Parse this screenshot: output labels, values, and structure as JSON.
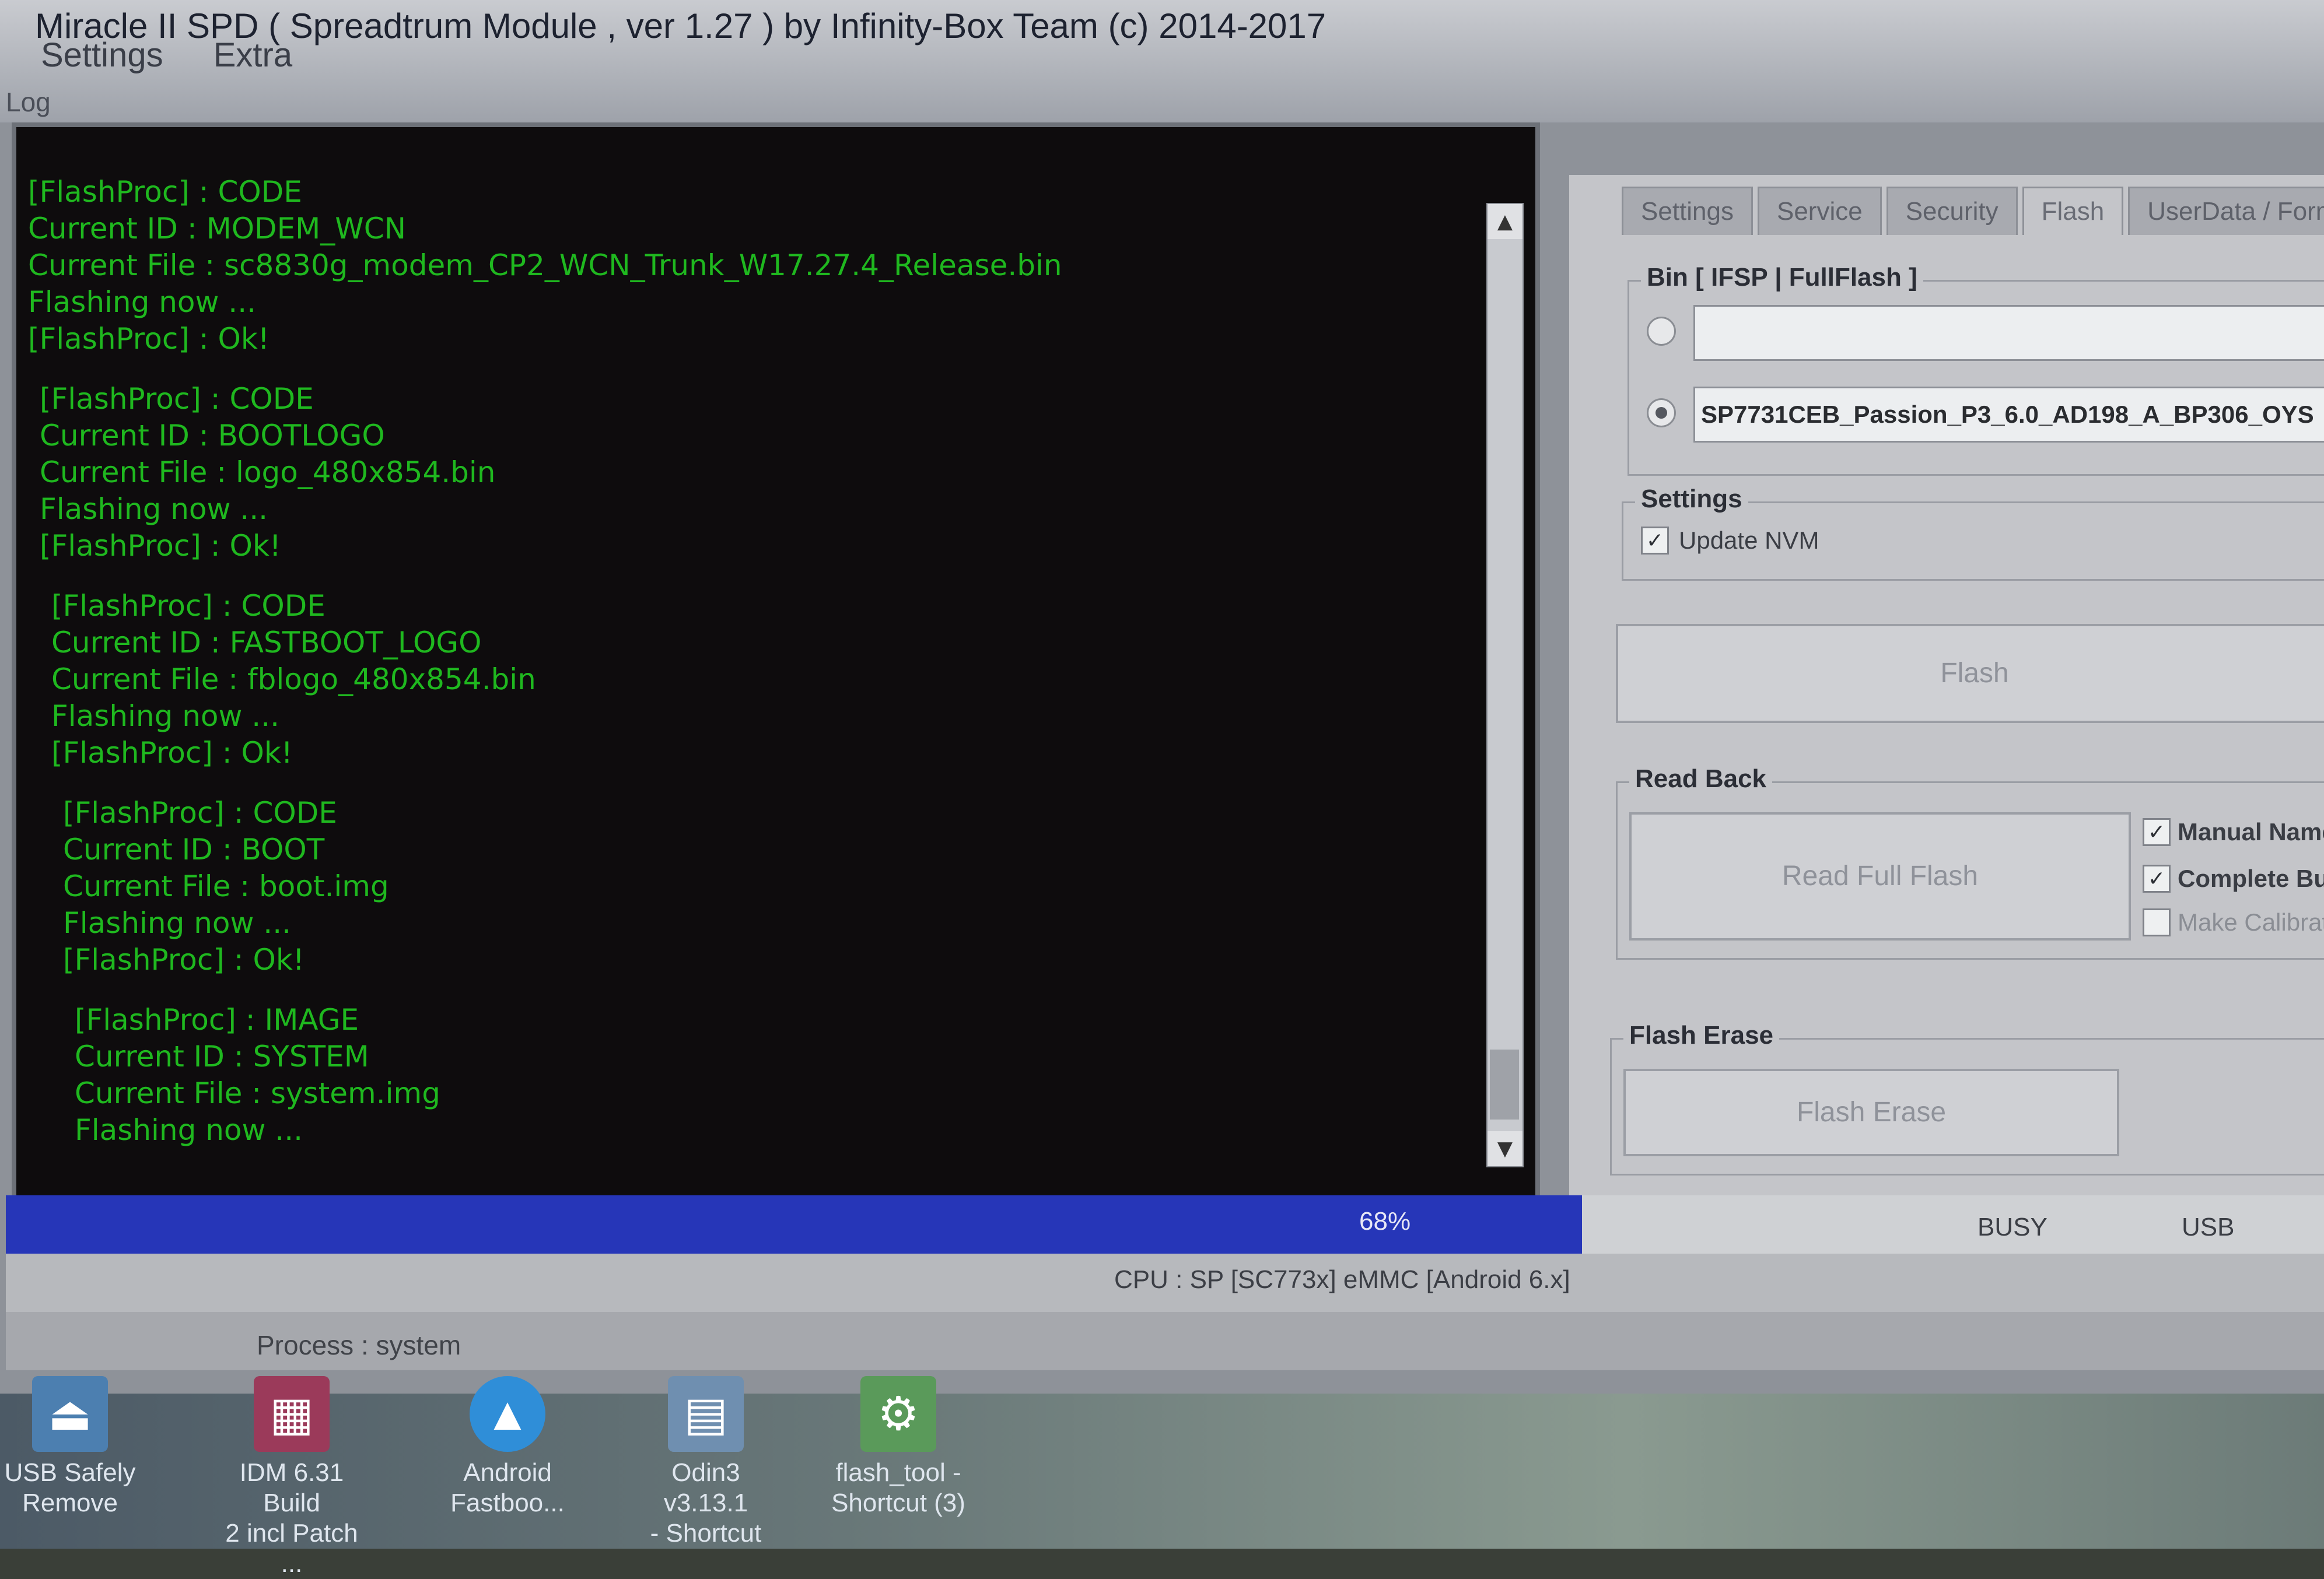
{
  "window": {
    "title": "Miracle II SPD ( Spreadtrum Module , ver 1.27 ) by Infinity-Box Team (c) 2014-2017",
    "menu": [
      "Settings",
      "Extra"
    ],
    "log_label": "Log"
  },
  "log": {
    "blocks": [
      {
        "lines": [
          "[FlashProc] : CODE",
          "Current ID : MODEM_WCN",
          "Current File : sc8830g_modem_CP2_WCN_Trunk_W17.27.4_Release.bin",
          "Flashing now ...",
          "[FlashProc] : Ok!"
        ]
      },
      {
        "lines": [
          "[FlashProc] : CODE",
          "Current ID : BOOTLOGO",
          "Current File : logo_480x854.bin",
          "Flashing now ...",
          "[FlashProc] : Ok!"
        ]
      },
      {
        "lines": [
          "[FlashProc] : CODE",
          "Current ID : FASTBOOT_LOGO",
          "Current File : fblogo_480x854.bin",
          "Flashing now ...",
          "[FlashProc] : Ok!"
        ]
      },
      {
        "lines": [
          "[FlashProc] : CODE",
          "Current ID : BOOT",
          "Current File : boot.img",
          "Flashing now ...",
          "[FlashProc] : Ok!"
        ]
      },
      {
        "lines": [
          "[FlashProc] : IMAGE",
          "Current ID : SYSTEM",
          "Current File : system.img",
          "Flashing now ..."
        ]
      }
    ],
    "text_color": "#1fb81f"
  },
  "tabs": [
    {
      "label": "Settings",
      "active": false
    },
    {
      "label": "Service",
      "active": false
    },
    {
      "label": "Security",
      "active": false
    },
    {
      "label": "Flash",
      "active": true
    },
    {
      "label": "UserData / Formats / O",
      "active": false
    }
  ],
  "bin_group": {
    "legend": "Bin [ IFSP | FullFlash ]",
    "option1_value": "",
    "option2_value": "SP7731CEB_Passion_P3_6.0_AD198_A_BP306_OYS"
  },
  "settings_group": {
    "legend": "Settings",
    "update_nvm_label": "Update NVM"
  },
  "flash_button": "Flash",
  "read_back": {
    "legend": "Read Back",
    "button": "Read Full Flash",
    "manual_name": "Manual Name",
    "complete_build": "Complete Bui",
    "make_calibration": "Make Calibrat"
  },
  "flash_erase": {
    "legend": "Flash Erase",
    "button": "Flash Erase"
  },
  "progress": {
    "percent_label": "68%",
    "value": 0.68,
    "busy_label": "BUSY",
    "usb_label": "USB"
  },
  "status": {
    "cpu": "CPU : SP [SC773x] eMMC [Android 6.x]",
    "process": "Process : system"
  },
  "desktop_icons": [
    {
      "label1": "USB Safely",
      "label2": "Remove",
      "icon": "usb-icon"
    },
    {
      "label1": "IDM 6.31 Build",
      "label2": "2 incl Patch ...",
      "icon": "winrar-icon"
    },
    {
      "label1": "Android",
      "label2": "Fastboo...",
      "icon": "android-icon"
    },
    {
      "label1": "Odin3 v3.13.1",
      "label2": "- Shortcut",
      "icon": "odin-icon"
    },
    {
      "label1": "flash_tool -",
      "label2": "Shortcut (3)",
      "icon": "flash-tool-icon"
    }
  ]
}
